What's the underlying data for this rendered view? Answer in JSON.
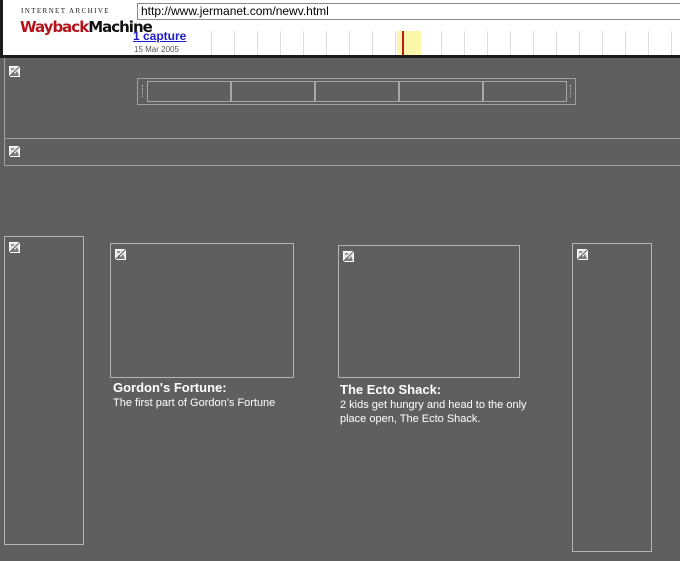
{
  "wayback": {
    "logo_top": "INTERNET ARCHIVE",
    "logo_way": "Wayback",
    "logo_machine": "Machine",
    "url": "http://www.jermanet.com/newv.html",
    "captures": "1 capture",
    "capture_date": "15 Mar 2005"
  },
  "stories": [
    {
      "title": "Gordon's Fortune:",
      "description": "The first part of Gordon's Fortune"
    },
    {
      "title": "The Ecto Shack:",
      "description": "2 kids get hungry and head to the only place open, The Ecto Shack."
    }
  ],
  "colors": {
    "page_background": "#5f5f5f",
    "capture_marker": "#c0181f",
    "year_highlight": "#fbf6a8",
    "link": "#1c1cc8"
  },
  "icons": {
    "broken_image": "broken-image-icon"
  }
}
